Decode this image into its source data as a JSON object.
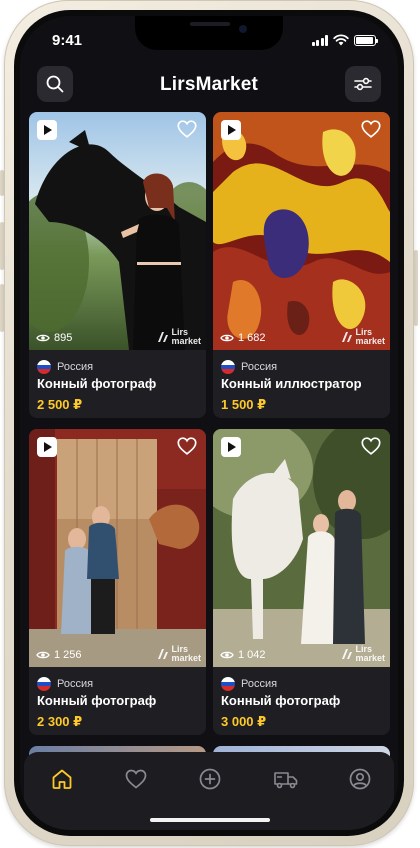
{
  "status_bar": {
    "time": "9:41"
  },
  "header": {
    "title": "LirsMarket",
    "search_icon": "search-icon",
    "filter_icon": "filter-sliders-icon"
  },
  "accent_color": "#ffc929",
  "watermark": {
    "line1": "Lirs",
    "line2": "market"
  },
  "cards": [
    {
      "views": "895",
      "country": "Россия",
      "title": "Конный фотограф",
      "price": "2 500 ₽"
    },
    {
      "views": "1 682",
      "country": "Россия",
      "title": "Конный иллюстратор",
      "price": "1 500 ₽"
    },
    {
      "views": "1 256",
      "country": "Россия",
      "title": "Конный фотограф",
      "price": "2 300 ₽"
    },
    {
      "views": "1 042",
      "country": "Россия",
      "title": "Конный фотограф",
      "price": "3 000 ₽"
    }
  ],
  "tab_bar": {
    "items": [
      {
        "icon": "home-icon",
        "active": true
      },
      {
        "icon": "heart-icon",
        "active": false
      },
      {
        "icon": "plus-circle-icon",
        "active": false
      },
      {
        "icon": "truck-icon",
        "active": false
      },
      {
        "icon": "profile-icon",
        "active": false
      }
    ]
  }
}
